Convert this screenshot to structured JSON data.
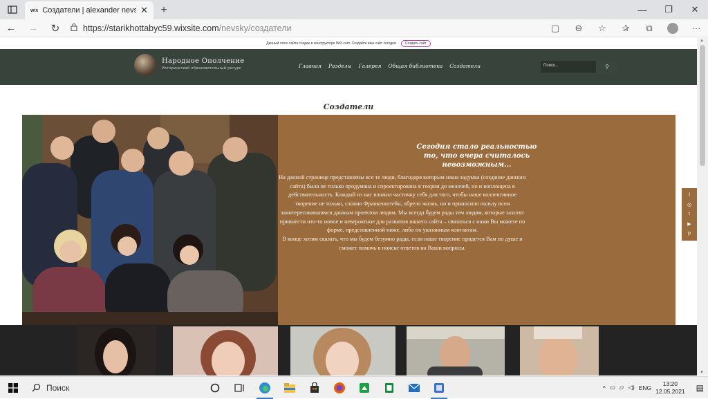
{
  "browser": {
    "tab": {
      "title": "Создатели | alexander nevsky",
      "favicon_text": "wix",
      "close_glyph": "✕"
    },
    "new_tab_glyph": "+",
    "window_controls": {
      "minimize": "—",
      "maximize": "❐",
      "close": "✕"
    },
    "url": {
      "host": "https://starikhottabyc59.wixsite.com",
      "path": "/nevsky/создатели"
    }
  },
  "wix_banner": {
    "text": "Данный этого сайта создан в конструкторе WiX.com. Создайте ваш сайт сегодня.",
    "button": "Создать сайт",
    "accent": "#b23bb0"
  },
  "site": {
    "brand_name": "Народное Ополчение",
    "brand_sub": "Исторический образовательный ресурс",
    "menu": [
      "Главная",
      "Разделы",
      "Галерея",
      "Общая библиотека",
      "Создатели"
    ],
    "search_placeholder": "Поиск...",
    "header_color": "#38433b",
    "section_title": "Создатели",
    "quote": [
      "Сегодня стало реальностью",
      "то, что вчера считалось",
      "невозможным..."
    ],
    "body": "На данной странице представлены все те люди, благодаря которым наша задумка (создание данного сайта) была не только продумана и спроектирована в теории до мелочей, но и воплощена в действительность. Каждый из нас вложил частичку себя для того, чтобы наше коллективное творение не только, словно Франкенштейн, обрело жизнь, но и приносило пользу всем заинтересовавшимся данным проектом людям. Мы всегда будем рады тем людям, которые захотят привнести что-то новое и невероятное для развития нашего сайта – связаться с нами Вы можете по форме, представленной ниже, либо по указанным контактам.",
    "closing": "В конце хотим сказать, что мы будем безумно рады, если наше творение придется Вам по душе и сможет помочь в поиске ответов на Ваши вопросы.",
    "panel_color": "#9a6b3d",
    "social": [
      "f",
      "◎",
      "t",
      "▶",
      "p"
    ]
  },
  "taskbar": {
    "search_label": "Поиск",
    "lang": "ENG",
    "time": "13:20",
    "date": "12.05.2021"
  }
}
